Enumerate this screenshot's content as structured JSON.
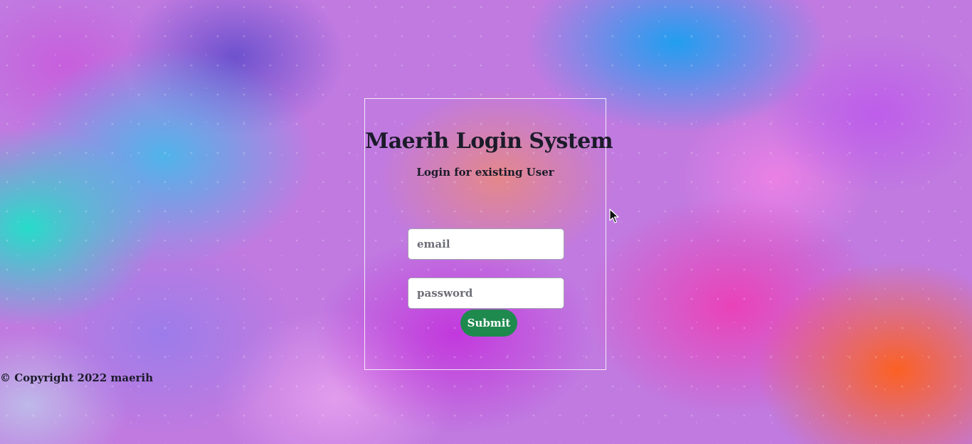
{
  "login": {
    "title": "Maerih Login System",
    "subtitle": "Login for existing User",
    "email_placeholder": "email",
    "email_value": "",
    "password_placeholder": "password",
    "password_value": "",
    "submit_label": "Submit"
  },
  "footer": {
    "copyright": "© Copyright 2022 maerih"
  },
  "colors": {
    "submit_background": "#1e8a4e",
    "text": "#1b1b2a",
    "card_border": "#ffffff"
  },
  "icons": {
    "pointer": "mouse-pointer-icon"
  }
}
